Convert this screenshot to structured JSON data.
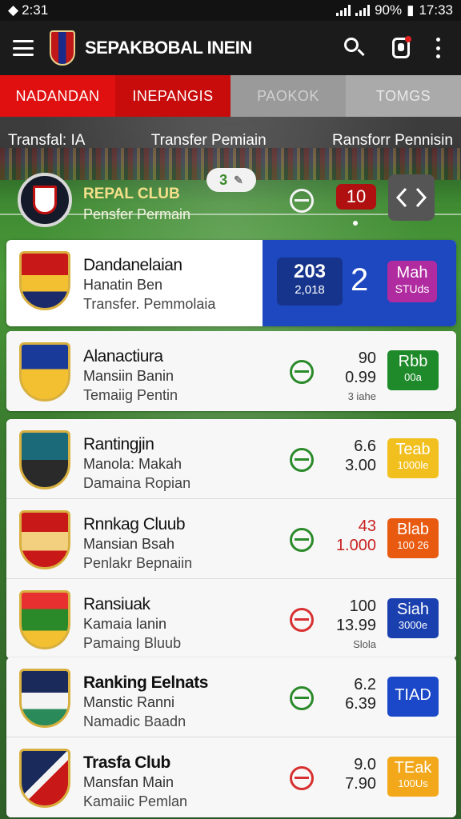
{
  "status_bar": {
    "time": "2:31",
    "battery": "90%",
    "clock": "17:33"
  },
  "app_bar": {
    "title": "SEPAKBOBAL INEIN"
  },
  "tabs": [
    {
      "label": "NADANDAN"
    },
    {
      "label": "INEPANGIS"
    },
    {
      "label": "PAOKOK"
    },
    {
      "label": "TOMGS"
    }
  ],
  "subtabs": [
    {
      "label": "Transfal: IA"
    },
    {
      "label": "Transfer Pemiain"
    },
    {
      "label": "Ransforr Pennisin"
    }
  ],
  "featured": {
    "title": "REPAL CLUB",
    "subtitle": "Pensfer Permain",
    "pill_value": "3",
    "badge": "10"
  },
  "highlight": {
    "name": "Dandanelaian",
    "line2": "Hanatin Ben",
    "line3": "Transfer. Pemmolaia",
    "stat_big": "203",
    "stat_small": "2,018",
    "number": "2",
    "chip_a": "Mah",
    "chip_b": "STUds"
  },
  "clubs": [
    {
      "name": "Alanactiura",
      "line2": "Mansiin Banin",
      "line3": "Temaiig Pentin",
      "v1": "90",
      "v2": "0.99",
      "v3": "3 iahe",
      "chip_a": "Rbb",
      "chip_b": "00a",
      "chip_color": "green",
      "toggle": "green"
    },
    {
      "name": "Rantingjin",
      "line2": "Manola: Makah",
      "line3": "Damaina Ropian",
      "v1": "6.6",
      "v2": "3.00",
      "v3": "",
      "chip_a": "Teab",
      "chip_b": "1000le",
      "chip_color": "yellow",
      "toggle": "green"
    },
    {
      "name": "Rnnkag Cluub",
      "line2": "Mansian Bsah",
      "line3": "Penlakr Bepnaiin",
      "v1": "43",
      "v2": "1.000",
      "v3": "",
      "chip_a": "Blab",
      "chip_b": "100 26",
      "chip_color": "orange",
      "toggle": "green",
      "red_values": true
    },
    {
      "name": "Ransiuak",
      "line2": "Kamaia lanin",
      "line3": "Pamaing Bluub",
      "v1": "100",
      "v2": "13.99",
      "v3": "Slola",
      "chip_a": "Siah",
      "chip_b": "3000e",
      "chip_color": "blue",
      "toggle": "red"
    },
    {
      "name": "Ranking Eelnats",
      "line2": "Manstic Ranni",
      "line3": "Namadic Baadn",
      "v1": "6.2",
      "v2": "6.39",
      "v3": "",
      "chip_a": "TIAD",
      "chip_b": "",
      "chip_color": "blue2",
      "toggle": "green",
      "bold": true
    },
    {
      "name": "Trasfa Club",
      "line2": "Mansfan Main",
      "line3": "Kamaiic Pemlan",
      "v1": "9.0",
      "v2": "7.90",
      "v3": "",
      "chip_a": "TEak",
      "chip_b": "100Us",
      "chip_color": "amber",
      "toggle": "red",
      "bold": true
    }
  ]
}
